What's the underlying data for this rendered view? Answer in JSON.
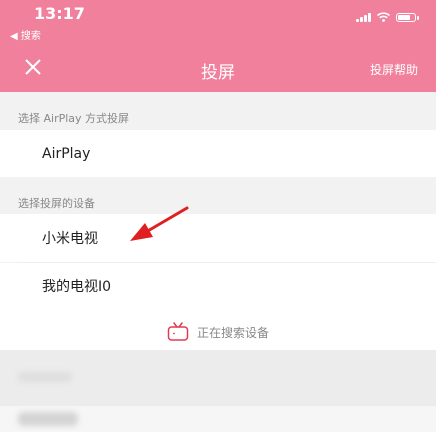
{
  "status_bar": {
    "time": "13:17",
    "back_label": "◀ 搜索"
  },
  "nav": {
    "title": "投屏",
    "help_label": "投屏帮助"
  },
  "airplay_section": {
    "label": "选择 AirPlay 方式投屏",
    "item": "AirPlay"
  },
  "device_section": {
    "label": "选择投屏的设备",
    "devices": [
      "小米电视",
      "我的电视I0"
    ]
  },
  "searching": {
    "text": "正在搜索设备"
  },
  "colors": {
    "header": "#f0809c",
    "accent": "#e23a52",
    "arrow": "#e02020"
  }
}
